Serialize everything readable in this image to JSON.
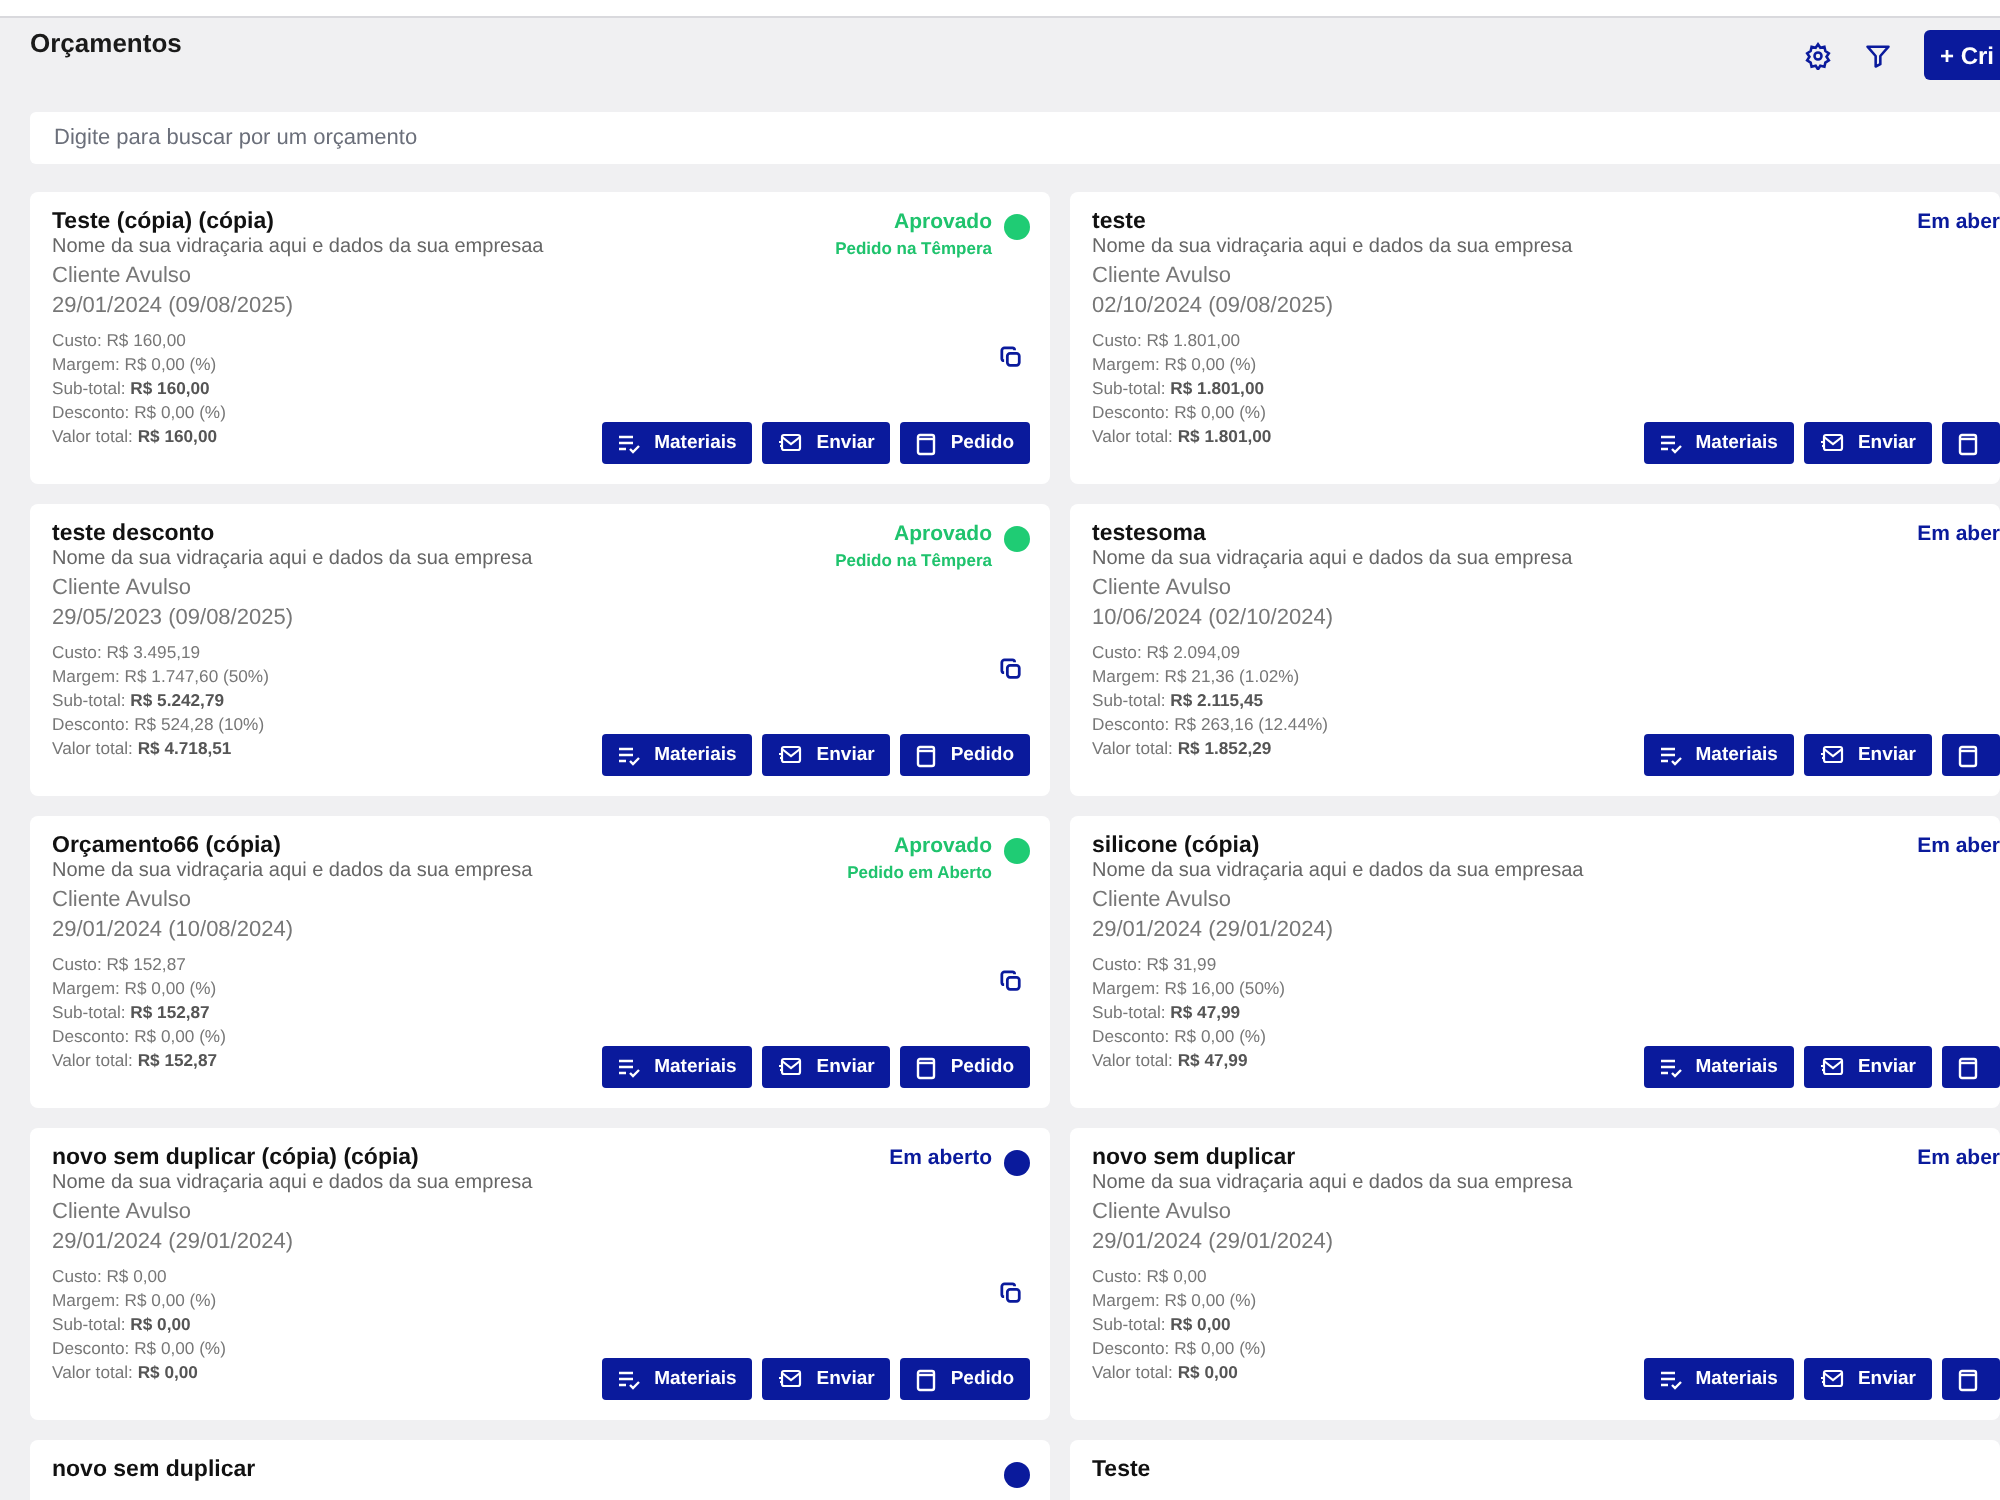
{
  "page": {
    "title": "Orçamentos",
    "create_button": "+ Cri"
  },
  "search": {
    "placeholder": "Digite para buscar por um orçamento"
  },
  "cards": [
    {
      "title": "Teste (cópia) (cópia)",
      "company": "Nome da sua vidraçaria aqui e dados da sua empresaa",
      "client": "Cliente Avulso",
      "date": "29/01/2024 (09/08/2025)",
      "status": {
        "kind": "approved",
        "label": "Aprovado",
        "sublabel": "Pedido na Têmpera",
        "color": "#1fcc74"
      },
      "lines": [
        "Custo: R$ 160,00",
        "Margem: R$ 0,00 (%)",
        "Sub-total: **R$ 160,00**",
        "Desconto: R$ 0,00 (%)",
        "Valor total: **R$ 160,00**"
      ],
      "buttons": [
        {
          "kind": "materials",
          "label": "Materiais"
        },
        {
          "kind": "send",
          "label": "Enviar"
        },
        {
          "kind": "order",
          "label": "Pedido"
        }
      ]
    },
    {
      "title": "teste",
      "company": "Nome da sua vidraçaria aqui e dados da sua empresa",
      "client": "Cliente Avulso",
      "date": "02/10/2024 (09/08/2025)",
      "status": {
        "kind": "open",
        "label": "Em aber"
      },
      "lines": [
        "Custo: R$ 1.801,00",
        "Margem: R$ 0,00 (%)",
        "Sub-total: **R$ 1.801,00**",
        "Desconto: R$ 0,00 (%)",
        "Valor total: **R$ 1.801,00**"
      ],
      "buttons": [
        {
          "kind": "materials",
          "label": "Materiais"
        },
        {
          "kind": "send",
          "label": "Enviar"
        },
        {
          "kind": "order"
        }
      ]
    },
    {
      "title": "teste desconto",
      "company": "Nome da sua vidraçaria aqui e dados da sua empresa",
      "client": "Cliente Avulso",
      "date": "29/05/2023 (09/08/2025)",
      "status": {
        "kind": "approved",
        "label": "Aprovado",
        "sublabel": "Pedido na Têmpera",
        "color": "#1fcc74"
      },
      "lines": [
        "Custo: R$ 3.495,19",
        "Margem: R$ 1.747,60 (50%)",
        "Sub-total: **R$ 5.242,79**",
        "Desconto: R$ 524,28 (10%)",
        "Valor total: **R$ 4.718,51**"
      ],
      "buttons": [
        {
          "kind": "materials",
          "label": "Materiais"
        },
        {
          "kind": "send",
          "label": "Enviar"
        },
        {
          "kind": "order",
          "label": "Pedido"
        }
      ]
    },
    {
      "title": "testesoma",
      "company": "Nome da sua vidraçaria aqui e dados da sua empresa",
      "client": "Cliente Avulso",
      "date": "10/06/2024 (02/10/2024)",
      "status": {
        "kind": "open",
        "label": "Em aber"
      },
      "lines": [
        "Custo: R$ 2.094,09",
        "Margem: R$ 21,36 (1.02%)",
        "Sub-total: **R$ 2.115,45**",
        "Desconto: R$ 263,16 (12.44%)",
        "Valor total: **R$ 1.852,29**"
      ],
      "buttons": [
        {
          "kind": "materials",
          "label": "Materiais"
        },
        {
          "kind": "send",
          "label": "Enviar"
        },
        {
          "kind": "order"
        }
      ]
    },
    {
      "title": "Orçamento66 (cópia)",
      "company": "Nome da sua vidraçaria aqui e dados da sua empresa",
      "client": "Cliente Avulso",
      "date": "29/01/2024 (10/08/2024)",
      "status": {
        "kind": "approved",
        "label": "Aprovado",
        "sublabel": "Pedido em Aberto",
        "color": "#1fcc74"
      },
      "lines": [
        "Custo: R$ 152,87",
        "Margem: R$ 0,00 (%)",
        "Sub-total: **R$ 152,87**",
        "Desconto: R$ 0,00 (%)",
        "Valor total: **R$ 152,87**"
      ],
      "buttons": [
        {
          "kind": "materials",
          "label": "Materiais"
        },
        {
          "kind": "send",
          "label": "Enviar"
        },
        {
          "kind": "order",
          "label": "Pedido"
        }
      ]
    },
    {
      "title": "silicone (cópia)",
      "company": "Nome da sua vidraçaria aqui e dados da sua empresaa",
      "client": "Cliente Avulso",
      "date": "29/01/2024 (29/01/2024)",
      "status": {
        "kind": "open",
        "label": "Em aber"
      },
      "lines": [
        "Custo: R$ 31,99",
        "Margem: R$ 16,00 (50%)",
        "Sub-total: **R$ 47,99**",
        "Desconto: R$ 0,00 (%)",
        "Valor total: **R$ 47,99**"
      ],
      "buttons": [
        {
          "kind": "materials",
          "label": "Materiais"
        },
        {
          "kind": "send",
          "label": "Enviar"
        },
        {
          "kind": "order"
        }
      ]
    },
    {
      "title": "novo sem duplicar (cópia) (cópia)",
      "company": "Nome da sua vidraçaria aqui e dados da sua empresa",
      "client": "Cliente Avulso",
      "date": "29/01/2024 (29/01/2024)",
      "status": {
        "kind": "open",
        "label": "Em aberto",
        "color": "#0a1a9c"
      },
      "lines": [
        "Custo: R$ 0,00",
        "Margem: R$ 0,00 (%)",
        "Sub-total: **R$ 0,00**",
        "Desconto: R$ 0,00 (%)",
        "Valor total: **R$ 0,00**"
      ],
      "buttons": [
        {
          "kind": "materials",
          "label": "Materiais"
        },
        {
          "kind": "send",
          "label": "Enviar"
        },
        {
          "kind": "order",
          "label": "Pedido"
        }
      ]
    },
    {
      "title": "novo sem duplicar",
      "company": "Nome da sua vidraçaria aqui e dados da sua empresa",
      "client": "Cliente Avulso",
      "date": "29/01/2024 (29/01/2024)",
      "status": {
        "kind": "open",
        "label": "Em aber"
      },
      "lines": [
        "Custo: R$ 0,00",
        "Margem: R$ 0,00 (%)",
        "Sub-total: **R$ 0,00**",
        "Desconto: R$ 0,00 (%)",
        "Valor total: **R$ 0,00**"
      ],
      "buttons": [
        {
          "kind": "materials",
          "label": "Materiais"
        },
        {
          "kind": "send",
          "label": "Enviar"
        },
        {
          "kind": "order"
        }
      ]
    },
    {
      "title": "novo sem duplicar",
      "status": {
        "kind": "open",
        "color": "#0a1a9c"
      }
    },
    {
      "title": "Teste"
    }
  ]
}
